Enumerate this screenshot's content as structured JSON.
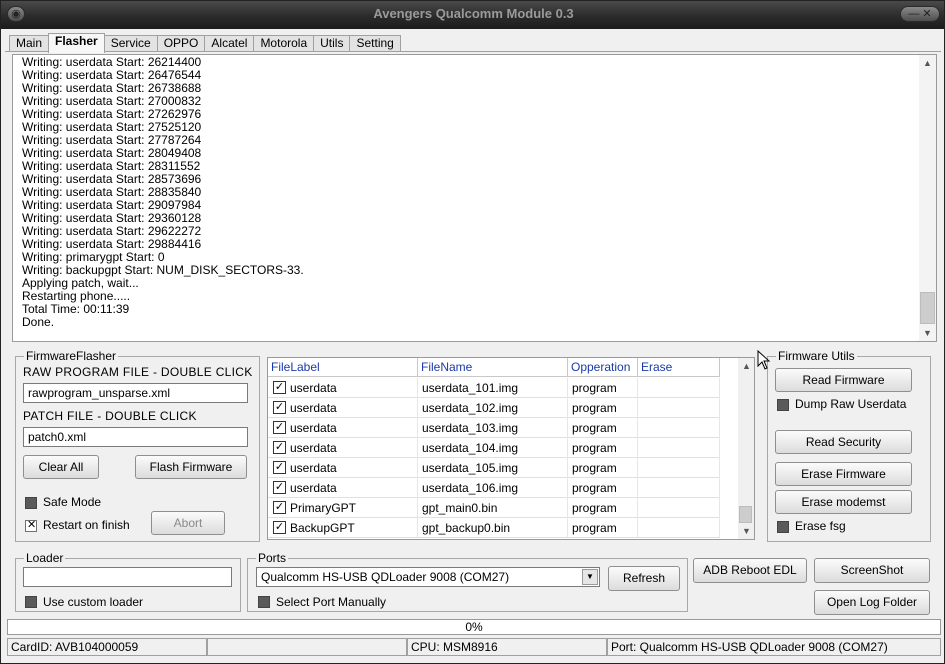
{
  "window": {
    "title": "Avengers Qualcomm Module 0.3",
    "menu_glyph": "◉",
    "controls_glyph": "— ✕"
  },
  "tabs": [
    {
      "label": "Main"
    },
    {
      "label": "Flasher"
    },
    {
      "label": "Service"
    },
    {
      "label": "OPPO"
    },
    {
      "label": "Alcatel"
    },
    {
      "label": "Motorola"
    },
    {
      "label": "Utils"
    },
    {
      "label": "Setting"
    }
  ],
  "active_tab": "Flasher",
  "log": [
    "Writing: userdata Start: 26214400",
    "Writing: userdata Start: 26476544",
    "Writing: userdata Start: 26738688",
    "Writing: userdata Start: 27000832",
    "Writing: userdata Start: 27262976",
    "Writing: userdata Start: 27525120",
    "Writing: userdata Start: 27787264",
    "Writing: userdata Start: 28049408",
    "Writing: userdata Start: 28311552",
    "Writing: userdata Start: 28573696",
    "Writing: userdata Start: 28835840",
    "Writing: userdata Start: 29097984",
    "Writing: userdata Start: 29360128",
    "Writing: userdata Start: 29622272",
    "Writing: userdata Start: 29884416",
    "Writing: primarygpt Start: 0",
    "Writing: backupgpt Start: NUM_DISK_SECTORS-33.",
    "Applying patch, wait...",
    "Restarting phone.....",
    "Total Time: 00:11:39",
    "Done."
  ],
  "firmware_flasher": {
    "legend": "FirmwareFlasher",
    "raw_label": "RAW PROGRAM FILE - DOUBLE CLICK",
    "raw_value": "rawprogram_unsparse.xml",
    "patch_label": "PATCH FILE - DOUBLE CLICK",
    "patch_value": "patch0.xml",
    "clear_all": "Clear All",
    "flash_firmware": "Flash Firmware",
    "safe_mode": "Safe Mode",
    "restart_on_finish": "Restart on finish",
    "abort": "Abort",
    "safe_mode_checked": false,
    "restart_checked": true
  },
  "file_grid": {
    "columns": [
      "FileLabel",
      "FileName",
      "Opperation",
      "Erase"
    ],
    "rows": [
      {
        "checked": true,
        "label": "userdata",
        "file": "userdata_101.img",
        "op": "program",
        "erase": ""
      },
      {
        "checked": true,
        "label": "userdata",
        "file": "userdata_102.img",
        "op": "program",
        "erase": ""
      },
      {
        "checked": true,
        "label": "userdata",
        "file": "userdata_103.img",
        "op": "program",
        "erase": ""
      },
      {
        "checked": true,
        "label": "userdata",
        "file": "userdata_104.img",
        "op": "program",
        "erase": ""
      },
      {
        "checked": true,
        "label": "userdata",
        "file": "userdata_105.img",
        "op": "program",
        "erase": ""
      },
      {
        "checked": true,
        "label": "userdata",
        "file": "userdata_106.img",
        "op": "program",
        "erase": ""
      },
      {
        "checked": true,
        "label": "PrimaryGPT",
        "file": "gpt_main0.bin",
        "op": "program",
        "erase": ""
      },
      {
        "checked": true,
        "label": "BackupGPT",
        "file": "gpt_backup0.bin",
        "op": "program",
        "erase": ""
      }
    ]
  },
  "firmware_utils": {
    "legend": "Firmware Utils",
    "read_firmware": "Read Firmware",
    "dump_raw_userdata": "Dump Raw Userdata",
    "read_security": "Read Security",
    "erase_firmware": "Erase Firmware",
    "erase_modemst": "Erase modemst",
    "erase_fsg": "Erase fsg"
  },
  "loader": {
    "legend": "Loader",
    "value": "",
    "use_custom_loader": "Use custom loader"
  },
  "ports": {
    "legend": "Ports",
    "selected": "Qualcomm HS-USB QDLoader 9008 (COM27)",
    "refresh": "Refresh",
    "select_manually": "Select Port Manually"
  },
  "actions": {
    "adb_reboot_edl": "ADB Reboot EDL",
    "screenshot": "ScreenShot",
    "open_log_folder": "Open Log Folder"
  },
  "progress": {
    "text": "0%",
    "value": 0
  },
  "status": {
    "card_id": "CardID: AVB104000059",
    "empty": "",
    "cpu": "CPU: MSM8916",
    "port": "Port: Qualcomm HS-USB QDLoader 9008 (COM27)"
  },
  "colors": {
    "header_text": "#1a3aa8",
    "titlebar": "#2b2b2b",
    "title_text": "#9a9a9a"
  },
  "icons": {
    "checked_glyph": "✓",
    "scroll_up": "▲",
    "scroll_down": "▼",
    "dropdown": "▼"
  }
}
